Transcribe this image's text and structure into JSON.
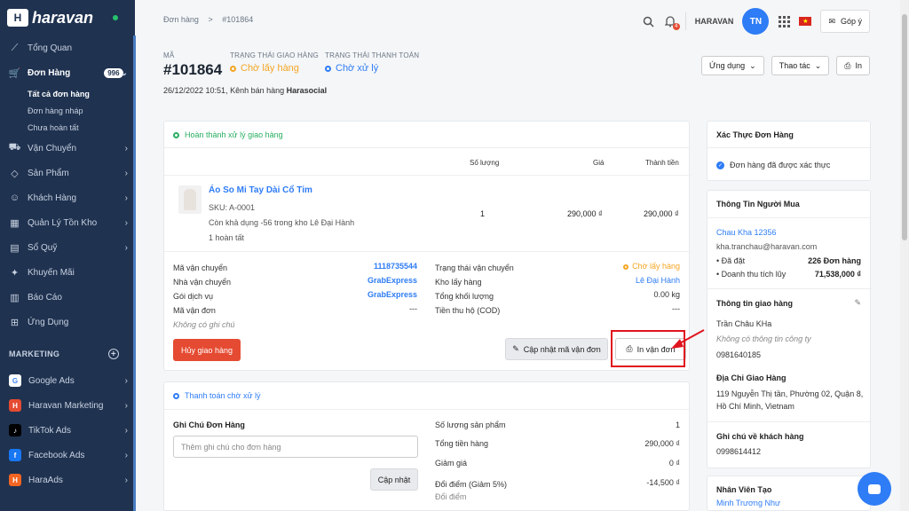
{
  "sidebar": {
    "logo_text": "haravan",
    "nav": [
      {
        "label": "Tổng Quan",
        "icon": "chart-line-icon",
        "chevron": false
      },
      {
        "label": "Đơn Hàng",
        "icon": "cart-icon",
        "badge": "996",
        "chevron": true
      },
      {
        "label": "Vận Chuyển",
        "icon": "truck-icon",
        "chevron": true
      },
      {
        "label": "Sản Phẩm",
        "icon": "tag-icon",
        "chevron": true
      },
      {
        "label": "Khách Hàng",
        "icon": "user-icon",
        "chevron": true
      },
      {
        "label": "Quản Lý Tồn Kho",
        "icon": "warehouse-icon",
        "chevron": true
      },
      {
        "label": "Sổ Quỹ",
        "icon": "ledger-icon",
        "chevron": true
      },
      {
        "label": "Khuyến Mãi",
        "icon": "gift-icon",
        "chevron": false
      },
      {
        "label": "Báo Cáo",
        "icon": "report-icon",
        "chevron": false
      },
      {
        "label": "Ứng Dụng",
        "icon": "apps-icon",
        "chevron": false
      }
    ],
    "sub": [
      "Tất cả đơn hàng",
      "Đơn hàng nháp",
      "Chưa hoàn tất"
    ],
    "marketing_title": "MARKETING",
    "marketing": [
      {
        "label": "Google Ads",
        "color": "#ffffff",
        "fg": "#4285f4",
        "glyph": "G"
      },
      {
        "label": "Haravan Marketing",
        "color": "#e54b32",
        "fg": "#ffffff",
        "glyph": "H"
      },
      {
        "label": "TikTok Ads",
        "color": "#000000",
        "fg": "#ffffff",
        "glyph": "♪"
      },
      {
        "label": "Facebook Ads",
        "color": "#1877f2",
        "fg": "#ffffff",
        "glyph": "f"
      },
      {
        "label": "HaraAds",
        "color": "#f26522",
        "fg": "#ffffff",
        "glyph": "H"
      }
    ]
  },
  "top": {
    "crumb_parent": "Đơn hàng",
    "crumb_sep": "#",
    "crumb_current": "#101864",
    "org": "HARAVAN",
    "avatar": "TN",
    "notif_count": "4",
    "feedback": "Góp ý"
  },
  "order": {
    "code_label": "MÃ",
    "code": "#101864",
    "ship_status_label": "TRẠNG THÁI GIAO HÀNG",
    "ship_status": "Chờ lấy hàng",
    "pay_status_label": "TRẠNG THÁI THANH TOÁN",
    "pay_status": "Chờ xử lý",
    "meta_prefix": "26/12/2022 10:51, Kênh bán hàng",
    "meta_channel": "Harasocial",
    "btn_apps": "Ứng dụng",
    "btn_actions": "Thao tác",
    "btn_print": "In"
  },
  "fulfill": {
    "title": "Hoàn thành xử lý giao hàng",
    "col_qty": "Số lượng",
    "col_price": "Giá",
    "col_total": "Thành tiền",
    "product_name": "Áo So Mi Tay Dài Cổ Tim",
    "sku": "SKU: A-0001",
    "stock": "Còn khả dụng -56 trong kho Lê Đại Hành",
    "done": "1 hoàn tất",
    "qty": "1",
    "price": "290,000 ₫",
    "total": "290,000 ₫",
    "left": [
      {
        "k": "Mã vận chuyển",
        "v": "1118735544"
      },
      {
        "k": "Nhà vận chuyển",
        "v": "GrabExpress"
      },
      {
        "k": "Gói dịch vụ",
        "v": "GrabExpress"
      },
      {
        "k": "Mã vận đơn",
        "v": "---"
      }
    ],
    "no_note": "Không có ghi chú",
    "right": [
      {
        "k": "Trạng thái vận chuyển",
        "v": "Chờ lấy hàng"
      },
      {
        "k": "Kho lấy hàng",
        "v": "Lê Đại Hành"
      },
      {
        "k": "Tổng khối lượng",
        "v": "0.00 kg"
      },
      {
        "k": "Tiền thu hộ (COD)",
        "v": "---"
      }
    ],
    "btn_cancel": "Hủy giao hàng",
    "btn_update": "Cập nhật mã vận đơn",
    "btn_print": "In vận đơn"
  },
  "payment": {
    "title": "Thanh toán chờ xử lý",
    "note_title": "Ghi Chú Đơn Hàng",
    "note_placeholder": "Thêm ghi chú cho đơn hàng",
    "btn_update": "Cập nhật",
    "rows": [
      {
        "k": "Số lượng sản phẩm",
        "v": "1"
      },
      {
        "k": "Tổng tiền hàng",
        "v": "290,000 ₫"
      },
      {
        "k": "Giảm giá",
        "v": "0 ₫"
      },
      {
        "k": "Đổi điểm (Giảm 5%)",
        "v": "-14,500 ₫"
      }
    ],
    "sub_label": "Đổi điểm"
  },
  "verify": {
    "title": "Xác Thực Đơn Hàng",
    "text": "Đơn hàng đã được xác thực"
  },
  "buyer": {
    "title": "Thông Tin Người Mua",
    "name": "Chau Kha 12356",
    "email": "kha.tranchau@haravan.com",
    "orders_label": "• Đã đặt",
    "orders_val": "226 Đơn hàng",
    "revenue_label": "• Doanh thu tích lũy",
    "revenue_val": "71,538,000 ₫",
    "ship_title": "Thông tin giao hàng",
    "ship_name": "Trần Châu KHa",
    "ship_company": "Không có thông tin công ty",
    "ship_phone": "0981640185",
    "addr_title": "Địa Chỉ Giao Hàng",
    "addr_line1": "119 Nguyễn Thị tần, Phường 02, Quận 8,",
    "addr_line2": "Hồ Chí Minh, Vietnam",
    "note_title": "Ghi chú về khách hàng",
    "note_phone": "0998614412"
  },
  "staff": {
    "title": "Nhân Viên Tạo",
    "name": "Minh Trương Như"
  }
}
